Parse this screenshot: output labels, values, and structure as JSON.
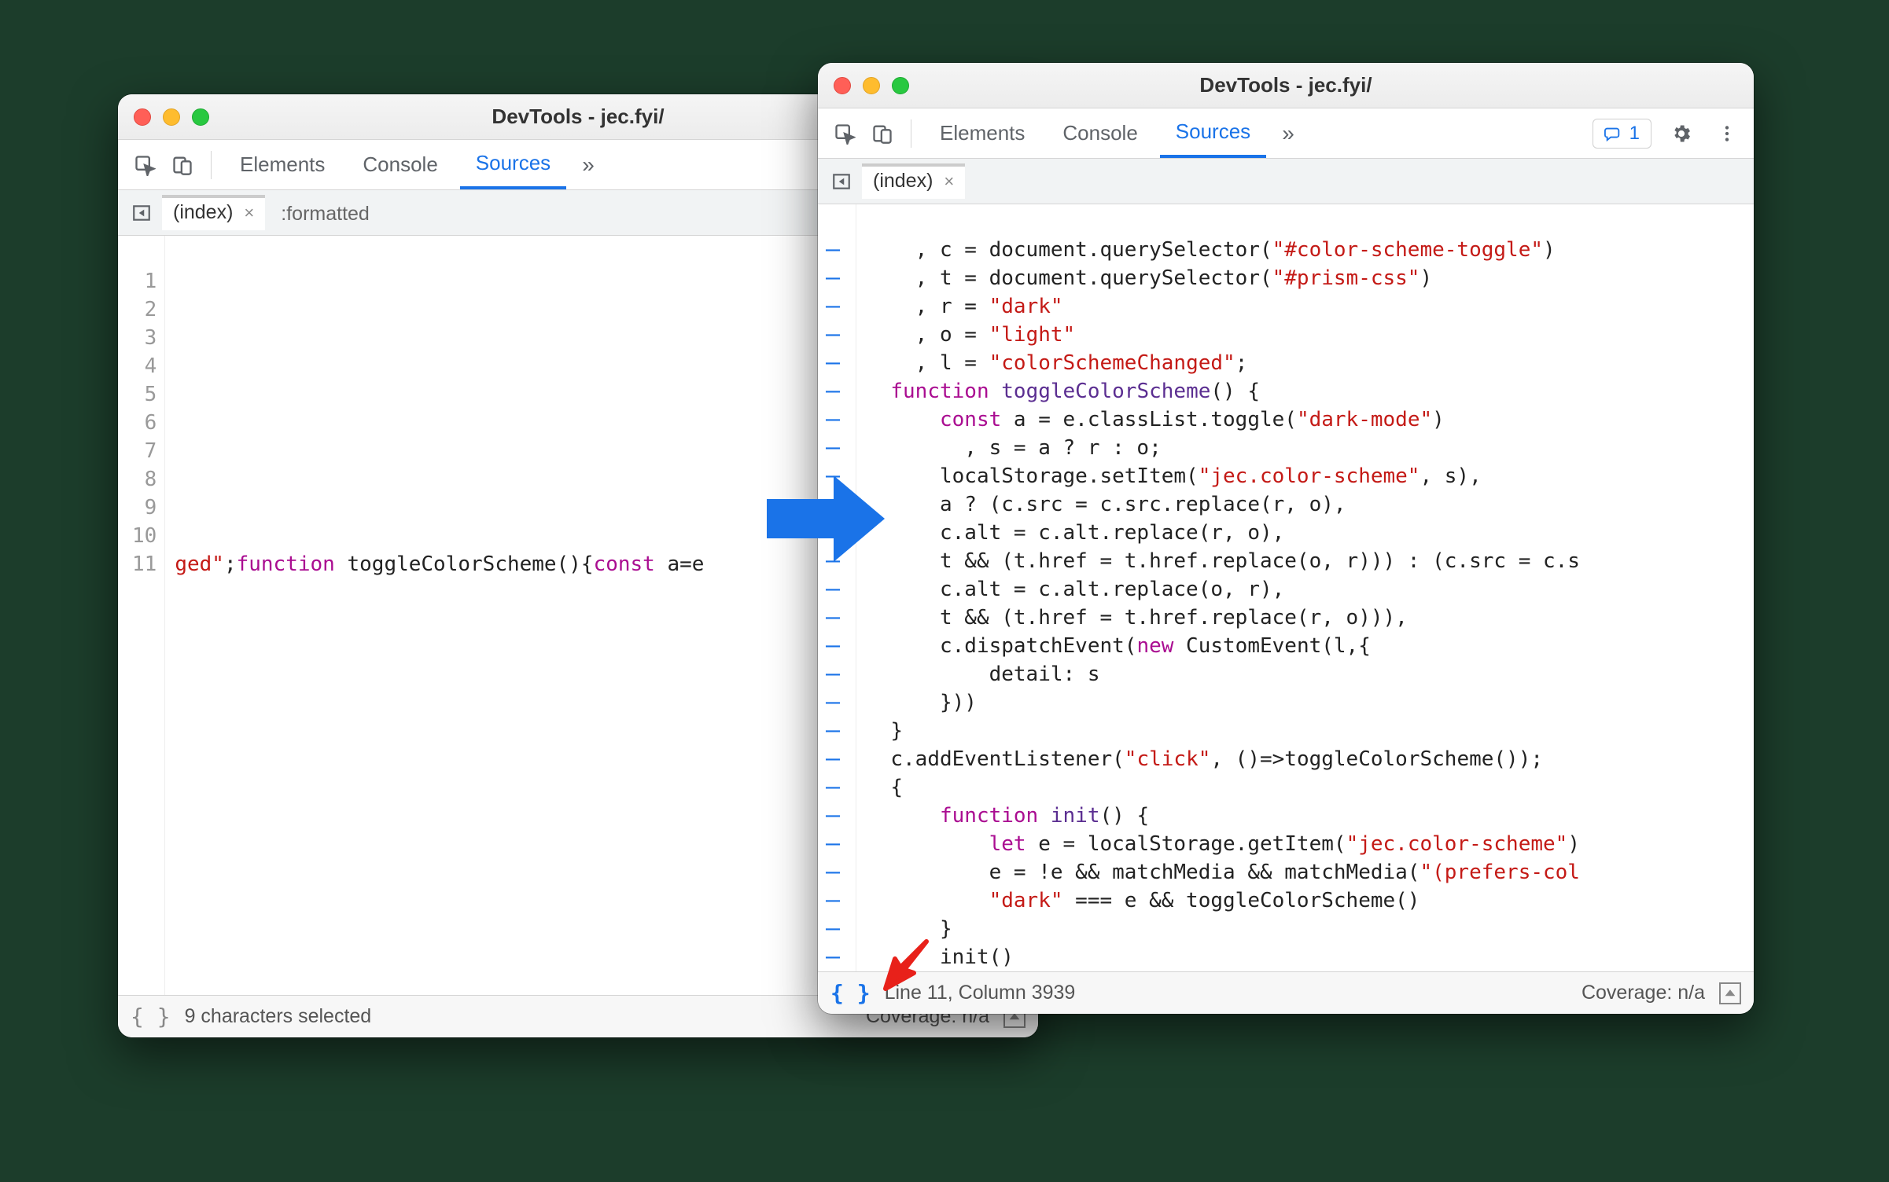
{
  "windowLeft": {
    "title": "DevTools - jec.fyi/",
    "tabs": {
      "elements": "Elements",
      "console": "Console",
      "sources": "Sources"
    },
    "fileTabs": {
      "index": "(index)",
      "formatted": ":formatted"
    },
    "gutter": [
      "1",
      "2",
      "3",
      "4",
      "5",
      "6",
      "7",
      "8",
      "9",
      "10",
      "11"
    ],
    "codeLine": {
      "seg1": "ged\"",
      "seg2": ";",
      "kw1": "function",
      "fn1": " toggleColorScheme(){",
      "kw2": "const",
      "seg3": " a=e"
    },
    "footer": {
      "status": "9 characters selected",
      "coverage": "Coverage: n/a"
    }
  },
  "windowRight": {
    "title": "DevTools - jec.fyi/",
    "tabs": {
      "elements": "Elements",
      "console": "Console",
      "sources": "Sources"
    },
    "issues": "1",
    "fileTabs": {
      "index": "(index)"
    },
    "dash": "–",
    "code": {
      "l1": {
        "a": "    , c = document.querySelector(",
        "s": "\"#color-scheme-toggle\"",
        "b": ")"
      },
      "l2": {
        "a": "    , t = document.querySelector(",
        "s": "\"#prism-css\"",
        "b": ")"
      },
      "l3": {
        "a": "    , r = ",
        "s": "\"dark\""
      },
      "l4": {
        "a": "    , o = ",
        "s": "\"light\""
      },
      "l5": {
        "a": "    , l = ",
        "s": "\"colorSchemeChanged\"",
        "b": ";"
      },
      "l6": {
        "k": "  function",
        "fn": " toggleColorScheme",
        "b": "() {"
      },
      "l7": {
        "k": "      const",
        "a": " a = e.classList.toggle(",
        "s": "\"dark-mode\"",
        "b": ")"
      },
      "l8": {
        "a": "        , s = a ? r : o;"
      },
      "l9": {
        "a": "      localStorage.setItem(",
        "s": "\"jec.color-scheme\"",
        "b": ", s),"
      },
      "l10": {
        "a": "      a ? (c.src = c.src.replace(r, o),"
      },
      "l11": {
        "a": "      c.alt = c.alt.replace(r, o),"
      },
      "l12": {
        "a": "      t && (t.href = t.href.replace(o, r))) : (c.src = c.s"
      },
      "l13": {
        "a": "      c.alt = c.alt.replace(o, r),"
      },
      "l14": {
        "a": "      t && (t.href = t.href.replace(r, o))),"
      },
      "l15": {
        "a": "      c.dispatchEvent(",
        "k": "new",
        "b": " CustomEvent(l,{"
      },
      "l16": {
        "a": "          detail: s"
      },
      "l17": {
        "a": "      }))"
      },
      "l18": {
        "a": "  }"
      },
      "l19": {
        "a": "  c.addEventListener(",
        "s": "\"click\"",
        "b": ", ()=>toggleColorScheme());"
      },
      "l20": {
        "a": "  {"
      },
      "l21": {
        "k": "      function",
        "fn": " init",
        "b": "() {"
      },
      "l22": {
        "k": "          let",
        "a": " e = localStorage.getItem(",
        "s": "\"jec.color-scheme\"",
        "b": ")"
      },
      "l23": {
        "a": "          e = !e && matchMedia && matchMedia(",
        "s": "\"(prefers-col"
      },
      "l24": {
        "s": "          \"dark\"",
        "a": " === e && toggleColorScheme()"
      },
      "l25": {
        "a": "      }"
      },
      "l26": {
        "a": "      init()"
      },
      "l27": {
        "a": "  }"
      },
      "l28": {
        "a": "}"
      }
    },
    "footer": {
      "cursor": "Line 11, Column 3939",
      "coverage": "Coverage: n/a"
    }
  }
}
